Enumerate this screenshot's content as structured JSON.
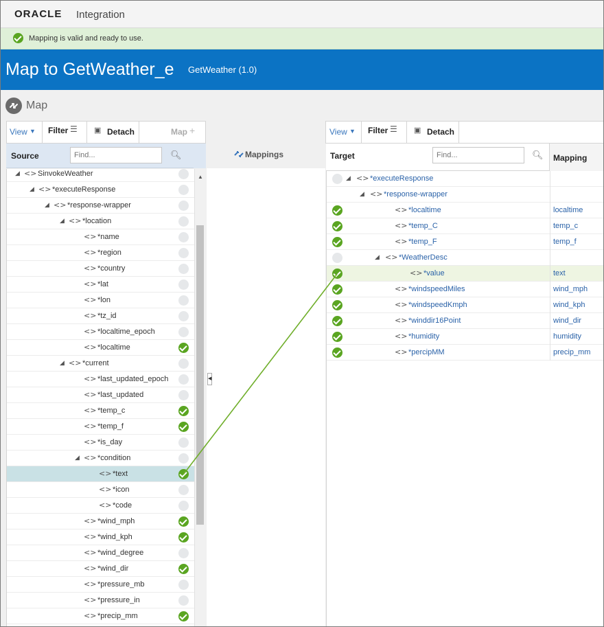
{
  "app": {
    "brand": "ORACLE",
    "product": "Integration"
  },
  "notice": {
    "text": "Mapping is valid and ready to use."
  },
  "banner": {
    "title": "Map to GetWeather_e",
    "version": "GetWeather (1.0)"
  },
  "breadcrumb": {
    "label": "Map"
  },
  "source": {
    "toolbar": {
      "view": "View",
      "filter": "Filter",
      "detach": "Detach",
      "map": "Map"
    },
    "header": "Source",
    "find_placeholder": "Find...",
    "rows": [
      {
        "name": "SinvokeWeather",
        "mapped": false,
        "expand": true
      },
      {
        "name": "*executeResponse",
        "mapped": false,
        "expand": true
      },
      {
        "name": "*response-wrapper",
        "mapped": false,
        "expand": true
      },
      {
        "name": "*location",
        "mapped": false,
        "expand": true
      },
      {
        "name": "*name",
        "mapped": false
      },
      {
        "name": "*region",
        "mapped": false
      },
      {
        "name": "*country",
        "mapped": false
      },
      {
        "name": "*lat",
        "mapped": false
      },
      {
        "name": "*lon",
        "mapped": false
      },
      {
        "name": "*tz_id",
        "mapped": false
      },
      {
        "name": "*localtime_epoch",
        "mapped": false
      },
      {
        "name": "*localtime",
        "mapped": true
      },
      {
        "name": "*current",
        "mapped": false,
        "expand": true
      },
      {
        "name": "*last_updated_epoch",
        "mapped": false
      },
      {
        "name": "*last_updated",
        "mapped": false
      },
      {
        "name": "*temp_c",
        "mapped": true
      },
      {
        "name": "*temp_f",
        "mapped": true
      },
      {
        "name": "*is_day",
        "mapped": false
      },
      {
        "name": "*condition",
        "mapped": false,
        "expand": true
      },
      {
        "name": "*text",
        "mapped": true,
        "selected": true
      },
      {
        "name": "*icon",
        "mapped": false
      },
      {
        "name": "*code",
        "mapped": false
      },
      {
        "name": "*wind_mph",
        "mapped": true
      },
      {
        "name": "*wind_kph",
        "mapped": true
      },
      {
        "name": "*wind_degree",
        "mapped": false
      },
      {
        "name": "*wind_dir",
        "mapped": true
      },
      {
        "name": "*pressure_mb",
        "mapped": false
      },
      {
        "name": "*pressure_in",
        "mapped": false
      },
      {
        "name": "*precip_mm",
        "mapped": true
      }
    ]
  },
  "middle": {
    "label": "Mappings"
  },
  "target": {
    "toolbar": {
      "view": "View",
      "filter": "Filter",
      "detach": "Detach"
    },
    "header": "Target",
    "mapping_header": "Mapping",
    "find_placeholder": "Find...",
    "rows": [
      {
        "name": "*executeResponse",
        "mapped": false,
        "expand": true,
        "mapping": ""
      },
      {
        "name": "*response-wrapper",
        "mapped": null,
        "expand": true,
        "mapping": ""
      },
      {
        "name": "*localtime",
        "mapped": true,
        "mapping": "localtime"
      },
      {
        "name": "*temp_C",
        "mapped": true,
        "mapping": "temp_c"
      },
      {
        "name": "*temp_F",
        "mapped": true,
        "mapping": "temp_f"
      },
      {
        "name": "*WeatherDesc",
        "mapped": false,
        "expand": true,
        "mapping": ""
      },
      {
        "name": "*value",
        "mapped": true,
        "mapping": "text",
        "highlight": true
      },
      {
        "name": "*windspeedMiles",
        "mapped": true,
        "mapping": "wind_mph"
      },
      {
        "name": "*windspeedKmph",
        "mapped": true,
        "mapping": "wind_kph"
      },
      {
        "name": "*winddir16Point",
        "mapped": true,
        "mapping": "wind_dir"
      },
      {
        "name": "*humidity",
        "mapped": true,
        "mapping": "humidity"
      },
      {
        "name": "*percipMM",
        "mapped": true,
        "mapping": "precip_mm"
      }
    ]
  },
  "colors": {
    "banner": "#0b73c4",
    "mapped_check": "#5aa521",
    "link": "#2a62a8",
    "selected_row": "#c9e1e5"
  }
}
